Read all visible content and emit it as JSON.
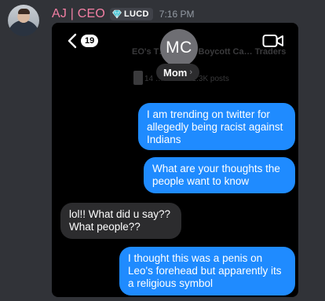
{
  "message": {
    "username": "AJ | CEO",
    "role_badge": "LUCD",
    "timestamp": "7:16 PM",
    "username_color": "#f47fa4"
  },
  "screenshot": {
    "back_count": "19",
    "contact_initials": "MC",
    "contact_name": "Mom",
    "contact_chevron": "›",
    "link_preview": {
      "title": "EO's T… Draws Boycott Ca… Traders",
      "meta": "14 … Other · 1.3K posts"
    },
    "messages": [
      {
        "side": "sent",
        "text": "I am trending on twitter for allegedly being racist against Indians"
      },
      {
        "side": "sent",
        "text": "What are your thoughts the people want to know"
      },
      {
        "side": "received",
        "text": "lol!! What did u say?? What people??"
      },
      {
        "side": "sent",
        "text": "I thought this was a penis on Leo's forehead but apparently its a religious symbol"
      }
    ],
    "colors": {
      "sent": "#1f8bff",
      "received": "#2c2c2e",
      "background": "#000000"
    },
    "icons": {
      "back": "chevron-left-icon",
      "video": "video-camera-icon"
    }
  }
}
